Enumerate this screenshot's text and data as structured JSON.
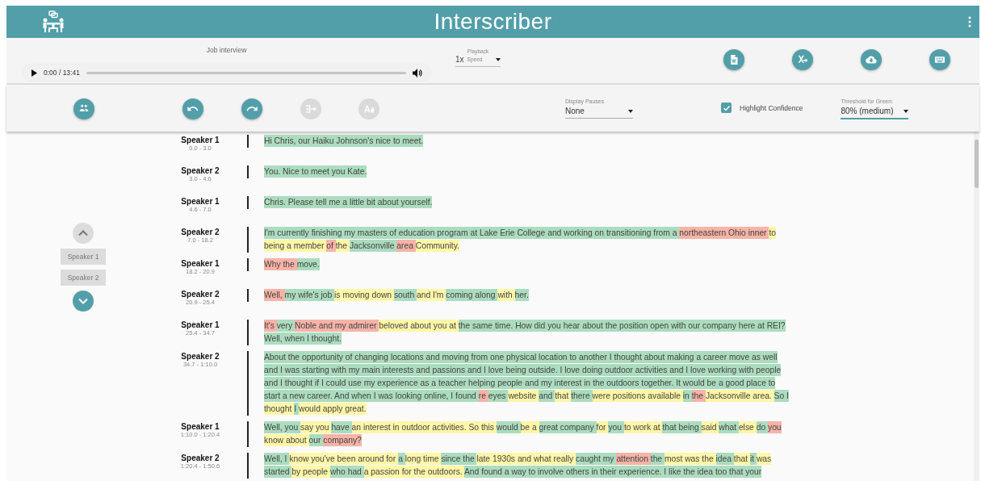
{
  "app": {
    "title": "Interscriber"
  },
  "player": {
    "title": "Job interview",
    "time": "0:00 / 13:41",
    "level": 0,
    "playback": {
      "label": "Playback",
      "value": "1x",
      "hint": "Speed"
    }
  },
  "toolbar": {
    "buttons": [
      {
        "disabled": false
      },
      {
        "disabled": false
      },
      {
        "disabled": false
      },
      {
        "disabled": true
      },
      {
        "disabled": true
      }
    ],
    "display_pauses": {
      "label": "Display Pauses",
      "value": "None"
    },
    "highlight_confidence": {
      "label": "Highlight Confidence",
      "checked": true
    },
    "threshold": {
      "label": "Threshold for Green:",
      "value": "80% (medium)"
    }
  },
  "navigator": {
    "up": {
      "disabled": true
    },
    "speakers": [
      {
        "label": "Speaker 1",
        "disabled": true
      },
      {
        "label": "Speaker 2",
        "disabled": true
      }
    ],
    "down": {
      "disabled": false
    }
  },
  "utterances": [
    {
      "speaker": "Speaker 1",
      "time": "0.0 - 3.0",
      "segments": [
        {
          "text": "Hi Chris, our Haiku Johnson's nice to meet.",
          "color": "#acdcbf"
        }
      ]
    },
    {
      "speaker": "Speaker 2",
      "time": "3.0 - 4.6",
      "segments": [
        {
          "text": "You. Nice to meet you Kate.",
          "color": "#acdcbf"
        }
      ]
    },
    {
      "speaker": "Speaker 1",
      "time": "4.6 - 7.0",
      "segments": [
        {
          "text": "Chris. Please tell me a little bit about yourself.",
          "color": "#acdcbf"
        }
      ]
    },
    {
      "speaker": "Speaker 2",
      "time": "7.0 - 18.2",
      "segments": [
        {
          "text": "I'm currently finishing my masters of education program at Lake Erie College and working on transitioning from a ",
          "color": "#acdcbf"
        },
        {
          "text": "northeastern Ohio inner ",
          "color": "#f6b3a7"
        },
        {
          "text": "to being a member ",
          "color": "#fff6a8"
        },
        {
          "text": "of ",
          "color": "#f6b3a7"
        },
        {
          "text": "the ",
          "color": "#fff6a8"
        },
        {
          "text": "Jacksonville ",
          "color": "#acdcbf"
        },
        {
          "text": "area ",
          "color": "#f6b3a7"
        },
        {
          "text": "Community.",
          "color": "#fff6a8"
        }
      ]
    },
    {
      "speaker": "Speaker 1",
      "time": "18.2 - 20.9",
      "segments": [
        {
          "text": "Why the ",
          "color": "#f6b3a7"
        },
        {
          "text": "move.",
          "color": "#acdcbf"
        }
      ]
    },
    {
      "speaker": "Speaker 2",
      "time": "20.9 - 25.4",
      "segments": [
        {
          "text": "Well, ",
          "color": "#f6b3a7"
        },
        {
          "text": "my wife's job ",
          "color": "#acdcbf"
        },
        {
          "text": "is moving down ",
          "color": "#fff6a8"
        },
        {
          "text": "south ",
          "color": "#acdcbf"
        },
        {
          "text": "and I'm ",
          "color": "#fff6a8"
        },
        {
          "text": "coming along ",
          "color": "#acdcbf"
        },
        {
          "text": "with ",
          "color": "#fff6a8"
        },
        {
          "text": "her.",
          "color": "#acdcbf"
        }
      ]
    },
    {
      "speaker": "Speaker 1",
      "time": "25.4 - 34.7",
      "segments": [
        {
          "text": "It's ",
          "color": "#f6b3a7"
        },
        {
          "text": "very ",
          "color": "#acdcbf"
        },
        {
          "text": "Noble and my admirer ",
          "color": "#f6b3a7"
        },
        {
          "text": "beloved about you at ",
          "color": "#fff6a8"
        },
        {
          "text": "the same time. How did you hear about the position open with our company here at REI? Well, when I thought.",
          "color": "#acdcbf"
        }
      ]
    },
    {
      "speaker": "Speaker 2",
      "time": "34.7 - 1:10.0",
      "segments": [
        {
          "text": "About the opportunity of changing locations and moving from one physical location to another I thought about making a career move as well and I was starting with my main interests and passions and I love being outside. I love doing outdoor activities and I love working with people and I thought if I could use my experience as a teacher helping people and my interest in the outdoors together. It would be a good place to start a new career. And when I was looking online, I found ",
          "color": "#acdcbf"
        },
        {
          "text": "re ",
          "color": "#f6b3a7"
        },
        {
          "text": "eyes ",
          "color": "#acdcbf"
        },
        {
          "text": "website ",
          "color": "#fff6a8"
        },
        {
          "text": "and ",
          "color": "#acdcbf"
        },
        {
          "text": "that ",
          "color": "#fff6a8"
        },
        {
          "text": "there ",
          "color": "#acdcbf"
        },
        {
          "text": "were positions available ",
          "color": "#fff6a8"
        },
        {
          "text": "in ",
          "color": "#acdcbf"
        },
        {
          "text": "the ",
          "color": "#f6b3a7"
        },
        {
          "text": "Jacksonville area. ",
          "color": "#fff6a8"
        },
        {
          "text": "So I ",
          "color": "#acdcbf"
        },
        {
          "text": "thought ",
          "color": "#fff6a8"
        },
        {
          "text": "I ",
          "color": "#acdcbf"
        },
        {
          "text": "would apply great.",
          "color": "#fff6a8"
        }
      ]
    },
    {
      "speaker": "Speaker 1",
      "time": "1:10.0 - 1:20.4",
      "segments": [
        {
          "text": "Well, you ",
          "color": "#acdcbf"
        },
        {
          "text": "say you ",
          "color": "#fff6a8"
        },
        {
          "text": "have ",
          "color": "#acdcbf"
        },
        {
          "text": "an interest in outdoor activities. So this ",
          "color": "#fff6a8"
        },
        {
          "text": "would ",
          "color": "#acdcbf"
        },
        {
          "text": "be a ",
          "color": "#fff6a8"
        },
        {
          "text": "great company ",
          "color": "#acdcbf"
        },
        {
          "text": "for ",
          "color": "#fff6a8"
        },
        {
          "text": "you ",
          "color": "#acdcbf"
        },
        {
          "text": "to work at ",
          "color": "#fff6a8"
        },
        {
          "text": "that being ",
          "color": "#acdcbf"
        },
        {
          "text": "said ",
          "color": "#fff6a8"
        },
        {
          "text": "what ",
          "color": "#acdcbf"
        },
        {
          "text": "else ",
          "color": "#fff6a8"
        },
        {
          "text": "do ",
          "color": "#acdcbf"
        },
        {
          "text": "you ",
          "color": "#f6b3a7"
        },
        {
          "text": "know about ",
          "color": "#fff6a8"
        },
        {
          "text": "our ",
          "color": "#acdcbf"
        },
        {
          "text": "company?",
          "color": "#f6b3a7"
        }
      ]
    },
    {
      "speaker": "Speaker 2",
      "time": "1:20.4 - 1:50.6",
      "segments": [
        {
          "text": "Well, I ",
          "color": "#acdcbf"
        },
        {
          "text": "know you've been around for ",
          "color": "#fff6a8"
        },
        {
          "text": "a ",
          "color": "#acdcbf"
        },
        {
          "text": "long time ",
          "color": "#fff6a8"
        },
        {
          "text": "since the ",
          "color": "#acdcbf"
        },
        {
          "text": "late 1930s and what really ",
          "color": "#fff6a8"
        },
        {
          "text": "caught my ",
          "color": "#acdcbf"
        },
        {
          "text": "attention ",
          "color": "#f6b3a7"
        },
        {
          "text": "the ",
          "color": "#acdcbf"
        },
        {
          "text": "most was the ",
          "color": "#fff6a8"
        },
        {
          "text": "idea ",
          "color": "#acdcbf"
        },
        {
          "text": "that ",
          "color": "#fff6a8"
        },
        {
          "text": "it ",
          "color": "#acdcbf"
        },
        {
          "text": "was ",
          "color": "#fff6a8"
        },
        {
          "text": "started ",
          "color": "#acdcbf"
        },
        {
          "text": "by people ",
          "color": "#fff6a8"
        },
        {
          "text": "who had ",
          "color": "#acdcbf"
        },
        {
          "text": "a passion for the outdoors. ",
          "color": "#fff6a8"
        },
        {
          "text": "And found a way to involve others in their experience. I like the idea too that your",
          "color": "#acdcbf"
        }
      ]
    }
  ]
}
